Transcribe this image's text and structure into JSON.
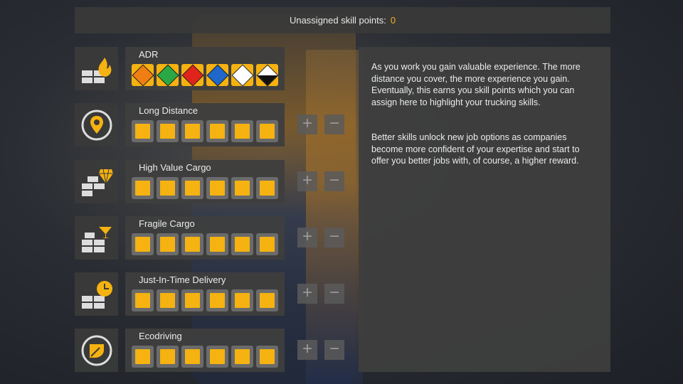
{
  "header": {
    "label": "Unassigned skill points:",
    "value": "0"
  },
  "skills": [
    {
      "name": "ADR",
      "icon": "adr-fire-icon",
      "adr_classes": [
        "explosives-icon",
        "gas-icon",
        "flammable-liquid-icon",
        "flammable-solid-icon",
        "toxic-icon",
        "corrosive-icon"
      ],
      "adr_colors": [
        "#f07e12",
        "#2aa845",
        "#e0241b",
        "#1f67c9",
        "#ffffff",
        "#ffffff"
      ]
    },
    {
      "name": "Long Distance",
      "icon": "location-pin-icon",
      "level": 6,
      "plus": "+",
      "minus": "−"
    },
    {
      "name": "High Value Cargo",
      "icon": "diamond-icon",
      "level": 6,
      "plus": "+",
      "minus": "−"
    },
    {
      "name": "Fragile Cargo",
      "icon": "glass-icon",
      "level": 6,
      "plus": "+",
      "minus": "−"
    },
    {
      "name": "Just-In-Time Delivery",
      "icon": "clock-icon",
      "level": 6,
      "plus": "+",
      "minus": "−"
    },
    {
      "name": "Ecodriving",
      "icon": "leaf-icon",
      "level": 6,
      "plus": "+",
      "minus": "−"
    }
  ],
  "info": {
    "paragraph1": "As you work you gain valuable experience. The more distance you cover, the more experience you gain. Eventually, this earns you skill points which you can assign here to highlight your trucking skills.",
    "paragraph2": "Better skills unlock new job options as companies become more confident of your expertise and start to offer you better jobs with, of course, a higher reward."
  },
  "colors": {
    "accent": "#f5b210",
    "panel": "#3e3e3e"
  }
}
